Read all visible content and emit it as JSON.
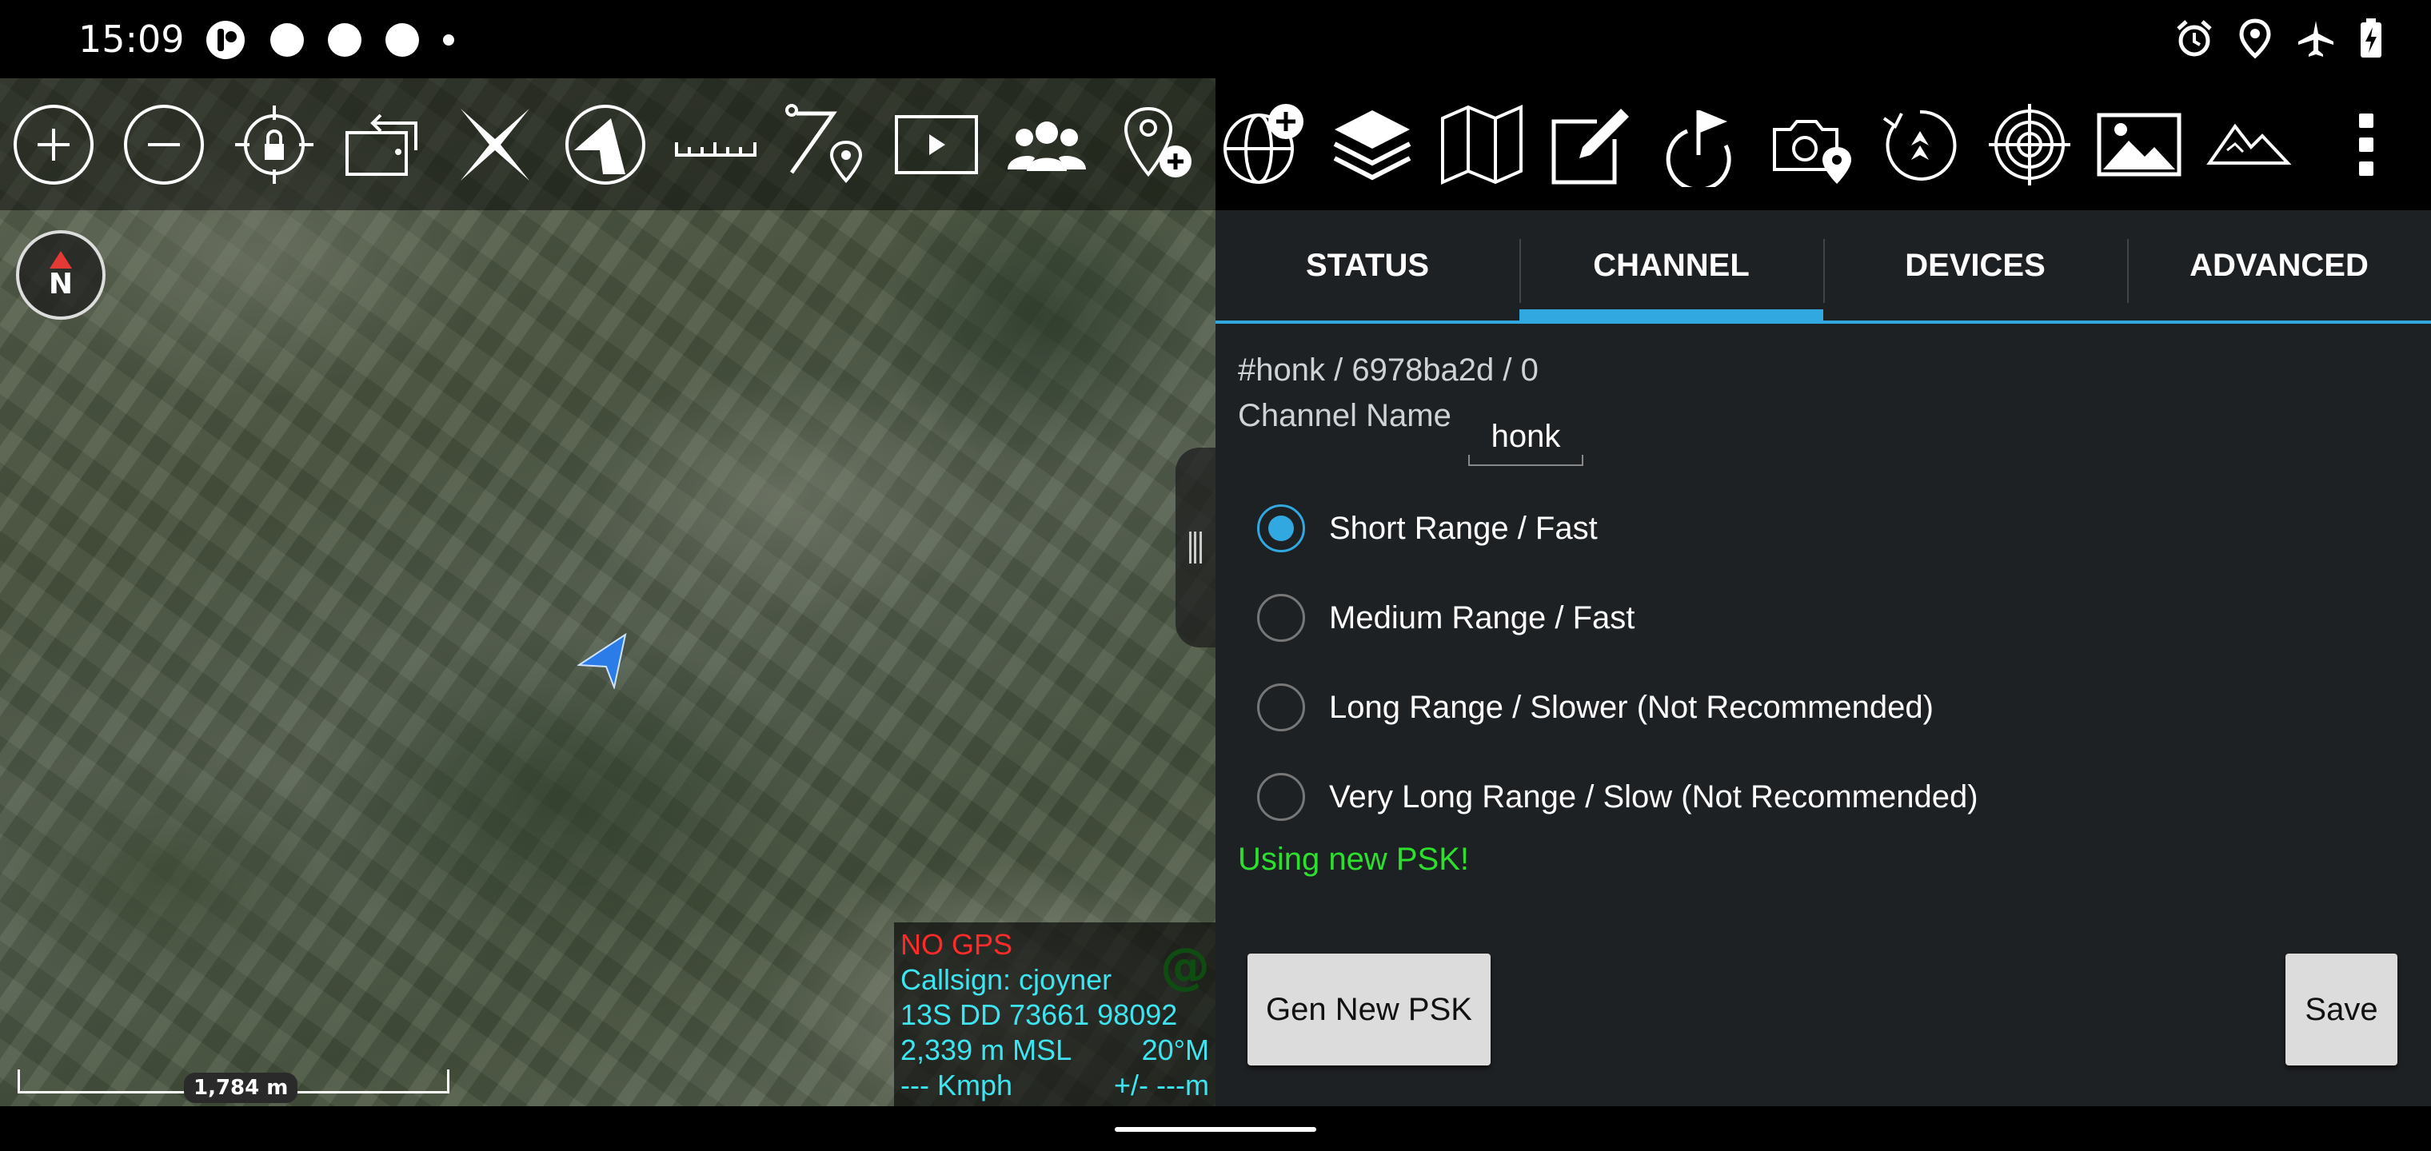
{
  "status_bar": {
    "time": "15:09",
    "left_icons": [
      "app-notification-icon",
      "notification-dot-icon",
      "notification-dot-icon",
      "notification-dot-icon",
      "more-notifications-dot-icon"
    ],
    "right_icons": [
      "alarm-icon",
      "location-icon",
      "airplane-mode-icon",
      "battery-charging-icon"
    ]
  },
  "map": {
    "toolbar_icons": [
      "zoom-in-icon",
      "zoom-out-icon",
      "lock-on-self-icon",
      "rotate-map-icon",
      "close-x-icon",
      "cone-tool-icon",
      "ruler-icon",
      "distance-to-point-icon",
      "video-play-icon",
      "contacts-icon",
      "add-marker-icon"
    ],
    "compass_label": "N",
    "info_box": {
      "gps_status": "NO GPS",
      "callsign": "Callsign: cjoyner",
      "coords": "13S  DD  73661   98092",
      "altitude": "2,339 m MSL",
      "heading": "20°M",
      "speed": "--- Kmph",
      "accuracy": "+/- ---m"
    },
    "scale_label": "1,784 m",
    "accent_color": "#3ee4f0",
    "alert_color": "#ff2a2a"
  },
  "right_toolbar": {
    "icons": [
      "add-globe-icon",
      "layers-icon",
      "map-icon",
      "edit-note-icon",
      "route-flag-icon",
      "camera-location-icon",
      "rotate-arrow-icon",
      "target-icon",
      "image-icon",
      "terrain-icon",
      "overflow-menu-icon"
    ]
  },
  "panel": {
    "tabs": [
      {
        "label": "STATUS",
        "active": false
      },
      {
        "label": "CHANNEL",
        "active": true
      },
      {
        "label": "DEVICES",
        "active": false
      },
      {
        "label": "ADVANCED",
        "active": false
      }
    ],
    "channel_id": "#honk  /  6978ba2d  /  0",
    "channel_name_label": "Channel Name",
    "channel_name_value": "honk",
    "range_options": [
      {
        "label": "Short Range / Fast",
        "selected": true
      },
      {
        "label": "Medium Range / Fast",
        "selected": false
      },
      {
        "label": "Long Range / Slower (Not Recommended)",
        "selected": false
      },
      {
        "label": "Very Long Range / Slow (Not Recommended)",
        "selected": false
      }
    ],
    "psk_status": "Using new PSK!",
    "gen_psk_label": "Gen New PSK",
    "save_label": "Save",
    "tab_accent_color": "#31a8e0",
    "psk_status_color": "#2ee02e"
  }
}
